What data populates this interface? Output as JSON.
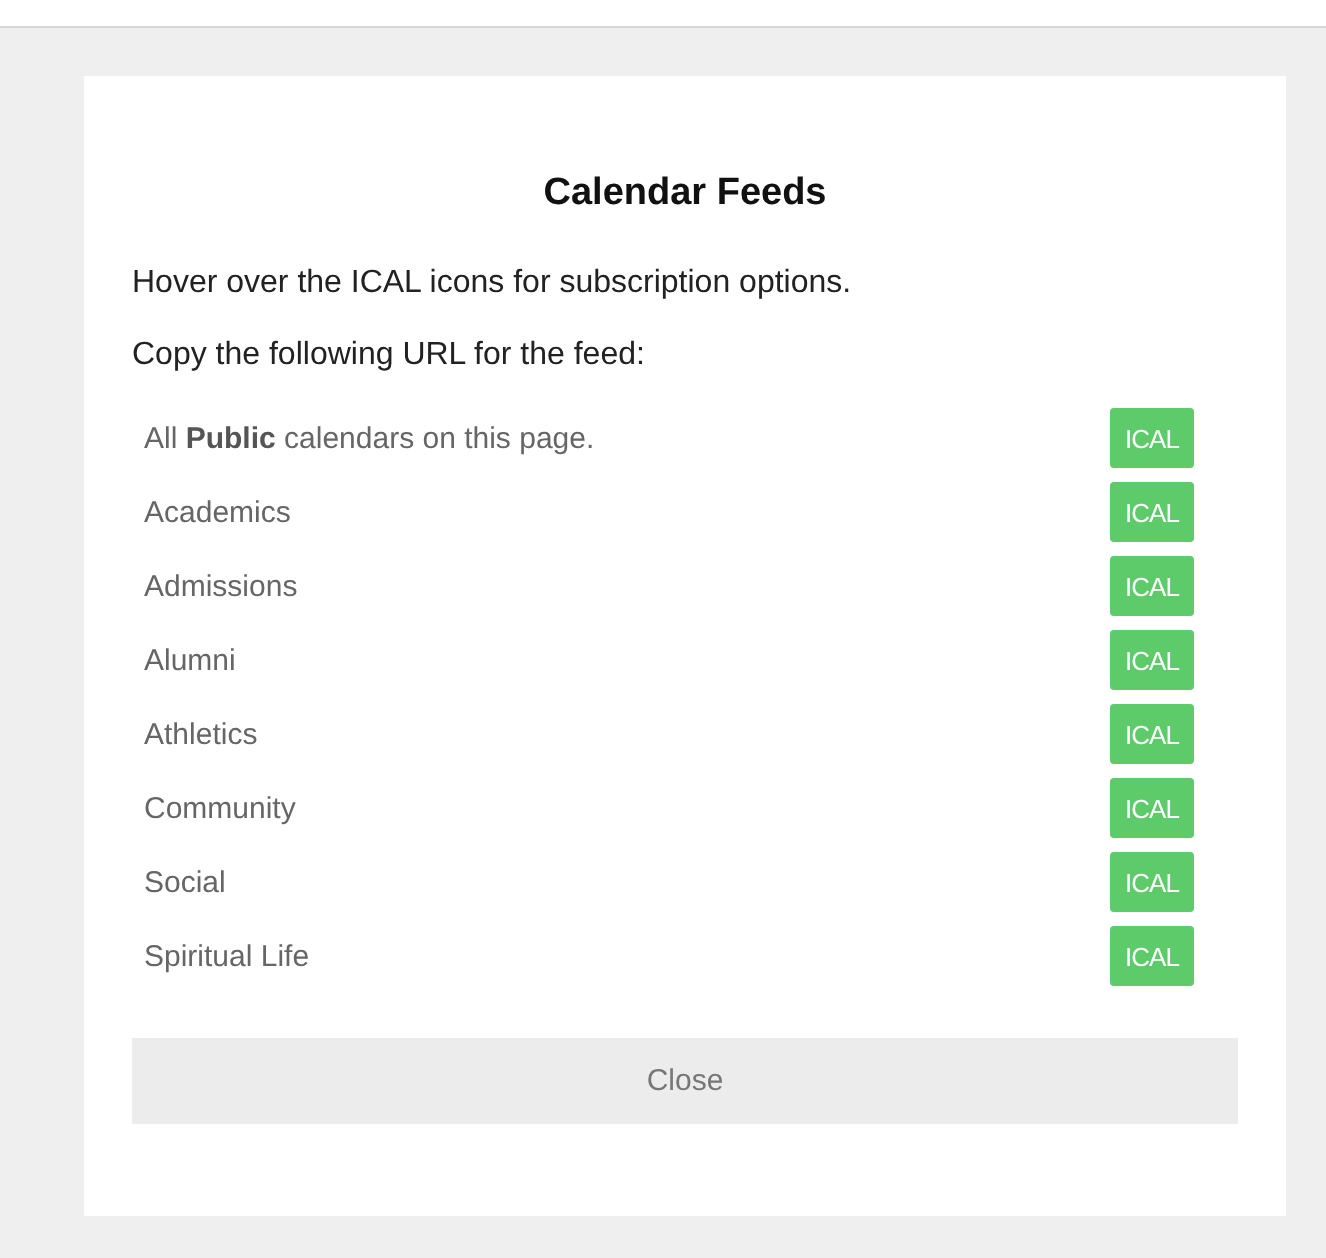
{
  "dialog": {
    "title": "Calendar Feeds",
    "intro": [
      "Hover over the ICAL icons for subscription options.",
      "Copy the following URL for the feed:"
    ],
    "feeds": [
      {
        "label": "All **Public** calendars on this page.",
        "badge": "ICAL"
      },
      {
        "label": "Academics",
        "badge": "ICAL"
      },
      {
        "label": "Admissions",
        "badge": "ICAL"
      },
      {
        "label": "Alumni",
        "badge": "ICAL"
      },
      {
        "label": "Athletics",
        "badge": "ICAL"
      },
      {
        "label": "Community",
        "badge": "ICAL"
      },
      {
        "label": "Social",
        "badge": "ICAL"
      },
      {
        "label": "Spiritual Life",
        "badge": "ICAL"
      }
    ],
    "close_button": "Close"
  }
}
